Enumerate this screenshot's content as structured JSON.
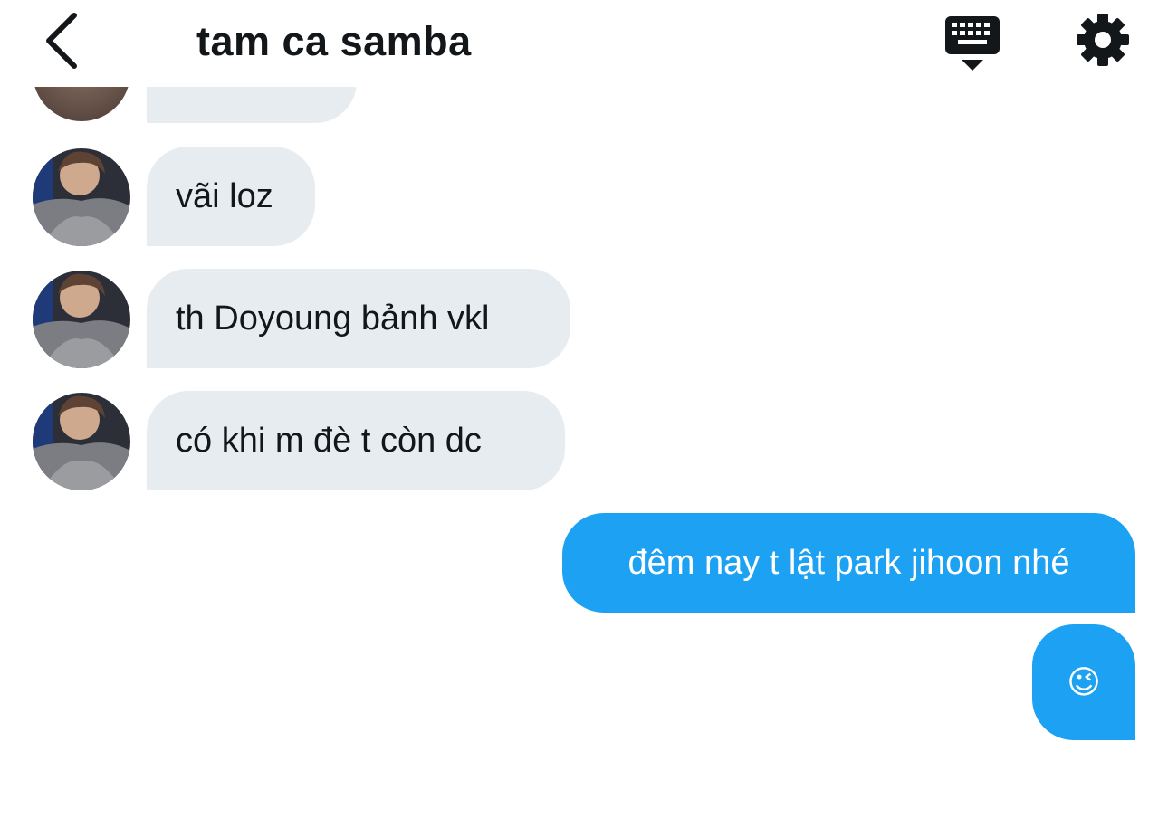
{
  "header": {
    "title": "tam ca samba",
    "back_icon": "chevron-left-icon",
    "keyboard_icon": "keyboard-icon",
    "settings_icon": "gear-icon"
  },
  "colors": {
    "incoming_bubble": "#e6ecf0",
    "outgoing_bubble": "#1da1f2",
    "text": "#14171a"
  },
  "messages": {
    "incoming": [
      {
        "text": "vãi loz"
      },
      {
        "text": "th Doyoung bảnh vkl"
      },
      {
        "text": "có khi m đè t còn dc"
      }
    ],
    "outgoing": [
      {
        "text": "đêm nay t lật park jihoon nhé"
      },
      {
        "text": "😉"
      }
    ]
  }
}
